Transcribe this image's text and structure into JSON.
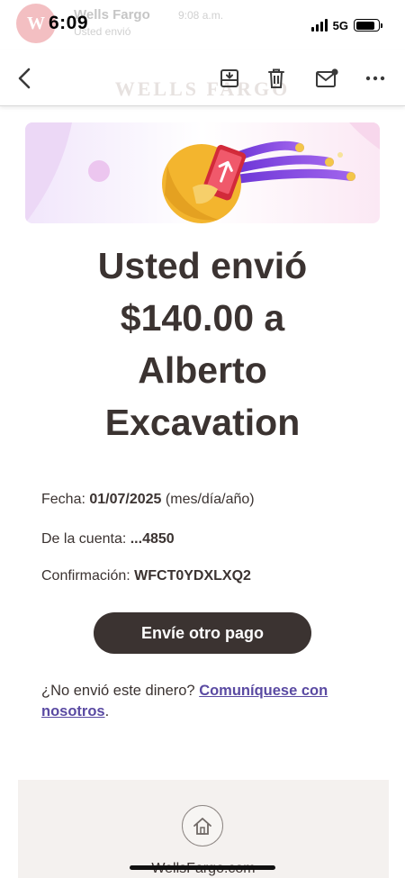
{
  "status_bar": {
    "time": "6:09",
    "network": "5G",
    "battery_level": 0.85
  },
  "notification": {
    "sender": "Wells Fargo",
    "logo_text": "W",
    "time": "9:08 a.m.",
    "subtitle": "Usted envió"
  },
  "toolbar": {
    "watermark": "WELLS FARGO",
    "icons": [
      "back-arrow-icon",
      "archive-icon",
      "trash-icon",
      "mark-unread-icon",
      "more-icon"
    ]
  },
  "email": {
    "title_lines": [
      "Usted envió",
      "$140.00 a",
      "Alberto",
      "Excavation"
    ],
    "date_label": "Fecha:",
    "date_value": "01/07/2025",
    "date_format": "(mes/día/año)",
    "account_label": "De la cuenta:",
    "account_value": "...4850",
    "confirmation_label": "Confirmación:",
    "confirmation_value": "WFCT0YDXLXQ2",
    "cta_label": "Envíe otro pago",
    "not_sent_text": "¿No envió este dinero? ",
    "contact_link": "Comuníquese con nosotros",
    "not_sent_end": "."
  },
  "footer": {
    "home_icon": "home-icon",
    "link_text": "WellsFargo.com"
  },
  "colors": {
    "text": "#3b3331",
    "link": "#5a4aa2",
    "button": "#3b3331",
    "accent_gold": "#f3b52e",
    "accent_purple": "#8a4fe0"
  }
}
